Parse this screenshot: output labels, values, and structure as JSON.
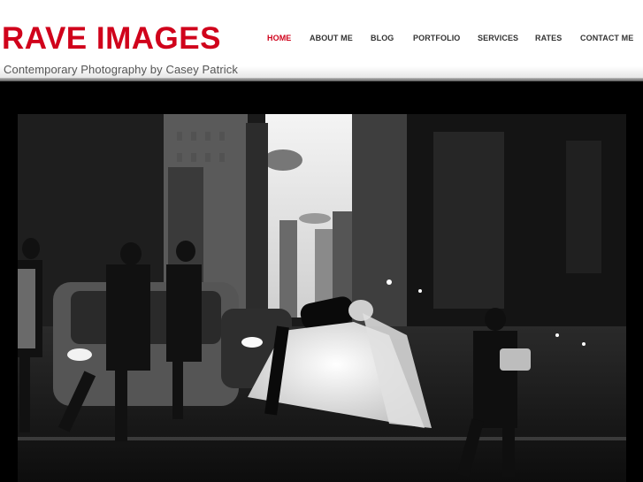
{
  "site": {
    "title": "RAVE IMAGES",
    "tagline": "Contemporary Photography by Casey Patrick"
  },
  "nav": {
    "items": [
      {
        "label": "HOME",
        "active": true
      },
      {
        "label": "ABOUT ME",
        "active": false
      },
      {
        "label": "BLOG",
        "active": false
      },
      {
        "label": "PORTFOLIO",
        "active": false
      },
      {
        "label": "SERVICES",
        "active": false
      },
      {
        "label": "RATES",
        "active": false
      },
      {
        "label": "CONTACT ME",
        "active": false
      }
    ]
  },
  "colors": {
    "brand": "#d0021b",
    "nav_text": "#333333",
    "tagline": "#555555",
    "background": "#000000"
  },
  "hero": {
    "image": "black-and-white-city-street-wedding-kiss-photo"
  }
}
